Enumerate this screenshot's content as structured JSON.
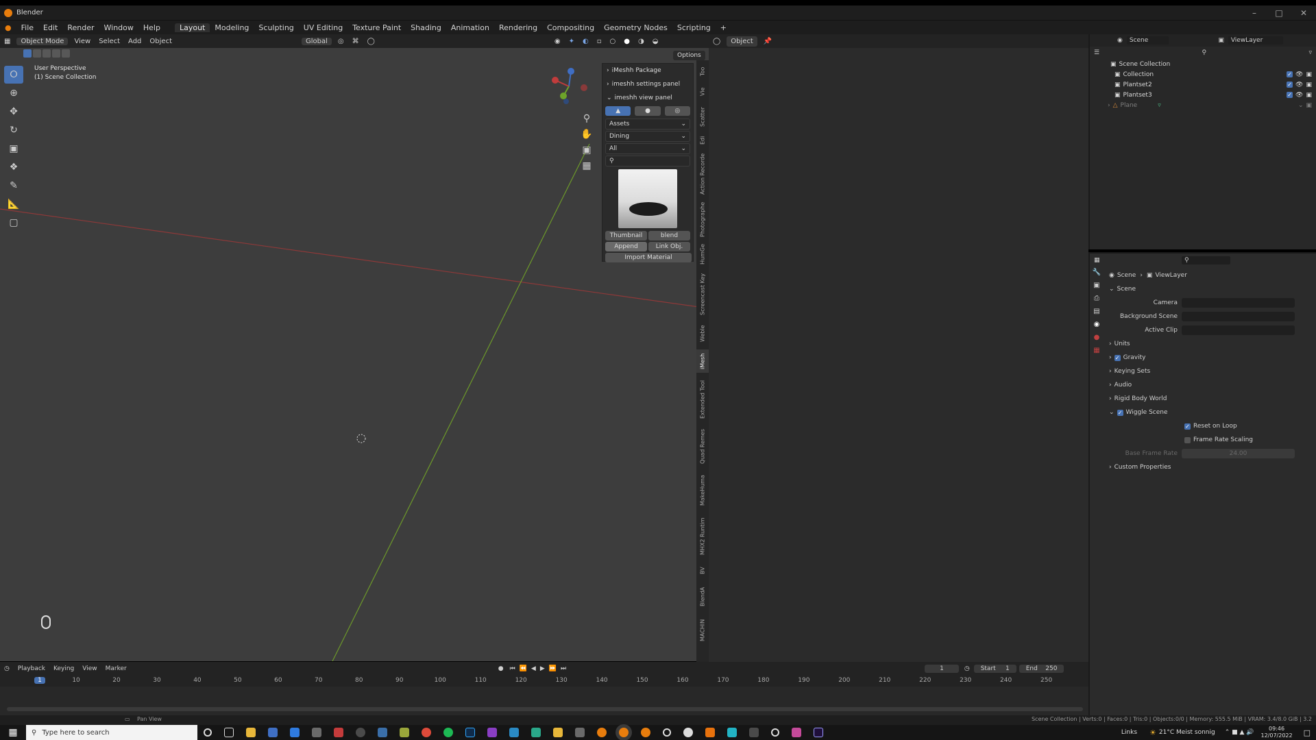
{
  "window": {
    "title": "Blender"
  },
  "menu": [
    "File",
    "Edit",
    "Render",
    "Window",
    "Help"
  ],
  "workspaces": [
    "Layout",
    "Modeling",
    "Sculpting",
    "UV Editing",
    "Texture Paint",
    "Shading",
    "Animation",
    "Rendering",
    "Compositing",
    "Geometry Nodes",
    "Scripting"
  ],
  "workspace_add": "+",
  "viewport_header": {
    "mode": "Object Mode",
    "menus": [
      "View",
      "Select",
      "Add",
      "Object"
    ],
    "orientation": "Global",
    "object_dd": "Object",
    "options": "Options"
  },
  "viewport": {
    "perspective": "User Perspective",
    "collection": "(1) Scene Collection"
  },
  "npanel": {
    "sections": [
      "iMeshh Package",
      "imeshh settings panel",
      "imeshh view panel"
    ],
    "selects": [
      "Assets",
      "Dining",
      "All"
    ],
    "buttons": {
      "thumbnail": "Thumbnail",
      "blend": "blend",
      "append": "Append",
      "link": "Link Obj.",
      "import_material": "Import Material"
    }
  },
  "side_tabs": [
    "Too",
    "Vie",
    "Scatter",
    "Edi",
    "Action Recorde",
    "Photographe",
    "HumGe",
    "Screencast Key",
    "Weble",
    "iMesh",
    "Extended Tool",
    "Quad Remes",
    "MakeHuma",
    "MHX2 Runtim",
    "BV",
    "BlendA",
    "MACHIN"
  ],
  "outliner": {
    "header_scene": "Scene",
    "header_viewlayer": "ViewLayer",
    "root": "Scene Collection",
    "items": [
      "Collection",
      "Plantset2",
      "Plantset3",
      "Plane"
    ]
  },
  "properties": {
    "breadcrumb": [
      "Scene",
      "ViewLayer"
    ],
    "section": "Scene",
    "fields": [
      "Camera",
      "Background Scene",
      "Active Clip"
    ],
    "panels": [
      "Units",
      "Gravity",
      "Keying Sets",
      "Audio",
      "Rigid Body World",
      "Wiggle Scene"
    ],
    "wiggle": {
      "reset": "Reset on Loop",
      "frame_scaling": "Frame Rate Scaling",
      "base_rate_label": "Base Frame Rate",
      "base_rate_value": "24.00"
    },
    "custom": "Custom Properties"
  },
  "timeline": {
    "menus": [
      "Playback",
      "Keying",
      "View",
      "Marker"
    ],
    "current_frame": "1",
    "start_label": "Start",
    "start": "1",
    "end_label": "End",
    "end": "250",
    "ticks": [
      "1",
      "10",
      "20",
      "30",
      "40",
      "50",
      "60",
      "70",
      "80",
      "90",
      "100",
      "110",
      "120",
      "130",
      "140",
      "150",
      "160",
      "170",
      "180",
      "190",
      "200",
      "210",
      "220",
      "230",
      "240",
      "250"
    ]
  },
  "statusbar": {
    "left": "Pan View",
    "right": "Scene Collection | Verts:0 | Faces:0 | Tris:0 | Objects:0/0 | Memory: 555.5 MiB | VRAM: 3.4/8.0 GiB | 3.2"
  },
  "taskbar": {
    "search": "Type here to search",
    "links": "Links",
    "weather": "21°C  Meist sonnig",
    "time": "09:46",
    "date": "12/07/2022"
  },
  "colors": {
    "accent": "#4772b3",
    "viewport": "#3d3d3d",
    "x_axis": "#a33a3a",
    "y_axis": "#6d9a2a"
  }
}
